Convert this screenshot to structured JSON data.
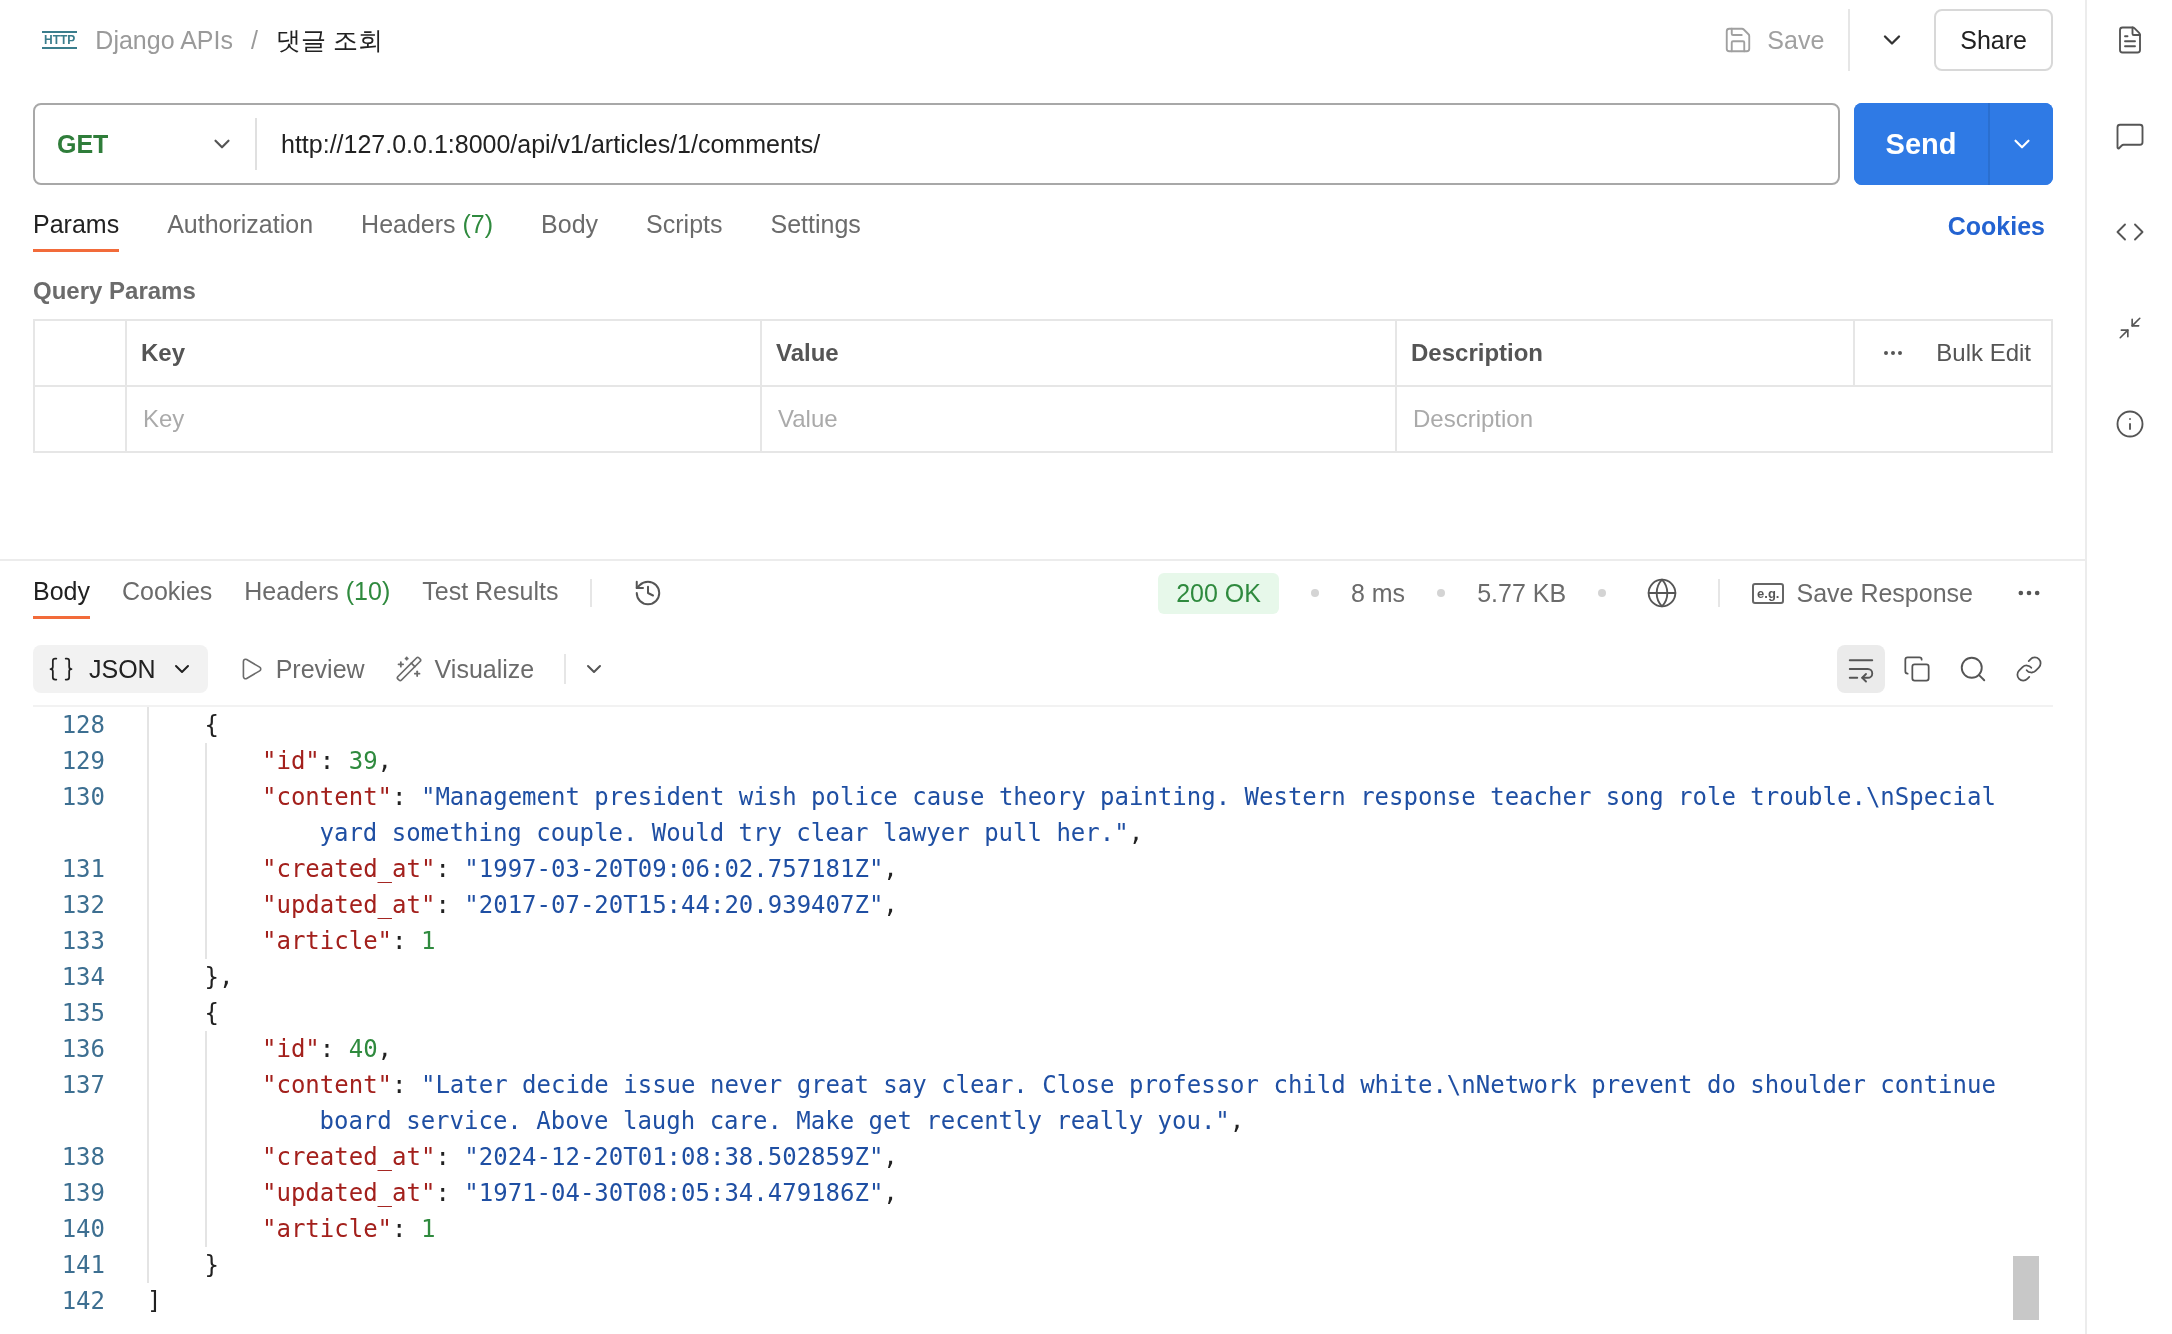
{
  "logo_text": "HTTP",
  "breadcrumb": {
    "collection": "Django APIs",
    "separator": "/",
    "request": "댓글 조회"
  },
  "header_actions": {
    "save": "Save",
    "share": "Share"
  },
  "request": {
    "method": "GET",
    "url": "http://127.0.0.1:8000/api/v1/articles/1/comments/",
    "send": "Send"
  },
  "request_tabs": [
    {
      "label": "Params",
      "selected": true
    },
    {
      "label": "Authorization",
      "selected": false
    },
    {
      "label": "Headers",
      "badge": "(7)",
      "selected": false
    },
    {
      "label": "Body",
      "selected": false
    },
    {
      "label": "Scripts",
      "selected": false
    },
    {
      "label": "Settings",
      "selected": false
    }
  ],
  "cookies_link": "Cookies",
  "query_params": {
    "title": "Query Params",
    "columns": [
      "Key",
      "Value",
      "Description"
    ],
    "bulk_edit": "Bulk Edit",
    "placeholders": [
      "Key",
      "Value",
      "Description"
    ]
  },
  "response": {
    "tabs": [
      {
        "label": "Body",
        "selected": true
      },
      {
        "label": "Cookies",
        "selected": false
      },
      {
        "label": "Headers",
        "badge": "(10)",
        "selected": false
      },
      {
        "label": "Test Results",
        "selected": false
      }
    ],
    "status": "200 OK",
    "time": "8 ms",
    "size": "5.77 KB",
    "example_badge": "e.g.",
    "save_response": "Save Response",
    "format": "JSON",
    "preview": "Preview",
    "visualize": "Visualize",
    "word_wrap": true
  },
  "code_lines": [
    {
      "children": [
        {
          "number": "128",
          "tokens": [
            {
              "kind": "punct",
              "text": "{"
            }
          ],
          "children": [
            {
              "number": "129",
              "tokens": [
                {
                  "kind": "key",
                  "text": "\"id\""
                },
                {
                  "kind": "punct",
                  "text": ": "
                },
                {
                  "kind": "number",
                  "text": "39"
                },
                {
                  "kind": "punct",
                  "text": ","
                }
              ]
            },
            {
              "number": "130",
              "tokens": [
                {
                  "kind": "key",
                  "text": "\"content\""
                },
                {
                  "kind": "punct",
                  "text": ": "
                },
                {
                  "kind": "string",
                  "text": "\"Management president wish police cause theory painting. Western response teacher song role trouble.\\nSpecial yard something couple. Would try clear lawyer pull her.\""
                },
                {
                  "kind": "punct",
                  "text": ","
                }
              ]
            },
            {
              "number": "131",
              "tokens": [
                {
                  "kind": "key",
                  "text": "\"created_at\""
                },
                {
                  "kind": "punct",
                  "text": ": "
                },
                {
                  "kind": "string",
                  "text": "\"1997-03-20T09:06:02.757181Z\""
                },
                {
                  "kind": "punct",
                  "text": ","
                }
              ]
            },
            {
              "number": "132",
              "tokens": [
                {
                  "kind": "key",
                  "text": "\"updated_at\""
                },
                {
                  "kind": "punct",
                  "text": ": "
                },
                {
                  "kind": "string",
                  "text": "\"2017-07-20T15:44:20.939407Z\""
                },
                {
                  "kind": "punct",
                  "text": ","
                }
              ]
            },
            {
              "number": "133",
              "tokens": [
                {
                  "kind": "key",
                  "text": "\"article\""
                },
                {
                  "kind": "punct",
                  "text": ": "
                },
                {
                  "kind": "number",
                  "text": "1"
                }
              ]
            }
          ]
        },
        {
          "number": "134",
          "tokens": [
            {
              "kind": "punct",
              "text": "},"
            }
          ]
        },
        {
          "number": "135",
          "tokens": [
            {
              "kind": "punct",
              "text": "{"
            }
          ],
          "children": [
            {
              "number": "136",
              "tokens": [
                {
                  "kind": "key",
                  "text": "\"id\""
                },
                {
                  "kind": "punct",
                  "text": ": "
                },
                {
                  "kind": "number",
                  "text": "40"
                },
                {
                  "kind": "punct",
                  "text": ","
                }
              ]
            },
            {
              "number": "137",
              "tokens": [
                {
                  "kind": "key",
                  "text": "\"content\""
                },
                {
                  "kind": "punct",
                  "text": ": "
                },
                {
                  "kind": "string",
                  "text": "\"Later decide issue never great say clear. Close professor child white.\\nNetwork prevent do shoulder continue board service. Above laugh care. Make get recently really you.\""
                },
                {
                  "kind": "punct",
                  "text": ","
                }
              ]
            },
            {
              "number": "138",
              "tokens": [
                {
                  "kind": "key",
                  "text": "\"created_at\""
                },
                {
                  "kind": "punct",
                  "text": ": "
                },
                {
                  "kind": "string",
                  "text": "\"2024-12-20T01:08:38.502859Z\""
                },
                {
                  "kind": "punct",
                  "text": ","
                }
              ]
            },
            {
              "number": "139",
              "tokens": [
                {
                  "kind": "key",
                  "text": "\"updated_at\""
                },
                {
                  "kind": "punct",
                  "text": ": "
                },
                {
                  "kind": "string",
                  "text": "\"1971-04-30T08:05:34.479186Z\""
                },
                {
                  "kind": "punct",
                  "text": ","
                }
              ]
            },
            {
              "number": "140",
              "tokens": [
                {
                  "kind": "key",
                  "text": "\"article\""
                },
                {
                  "kind": "punct",
                  "text": ": "
                },
                {
                  "kind": "number",
                  "text": "1"
                }
              ]
            }
          ]
        },
        {
          "number": "141",
          "tokens": [
            {
              "kind": "punct",
              "text": "}"
            }
          ]
        }
      ]
    },
    {
      "number": "142",
      "tokens": [
        {
          "kind": "punct",
          "text": "]"
        }
      ]
    }
  ]
}
